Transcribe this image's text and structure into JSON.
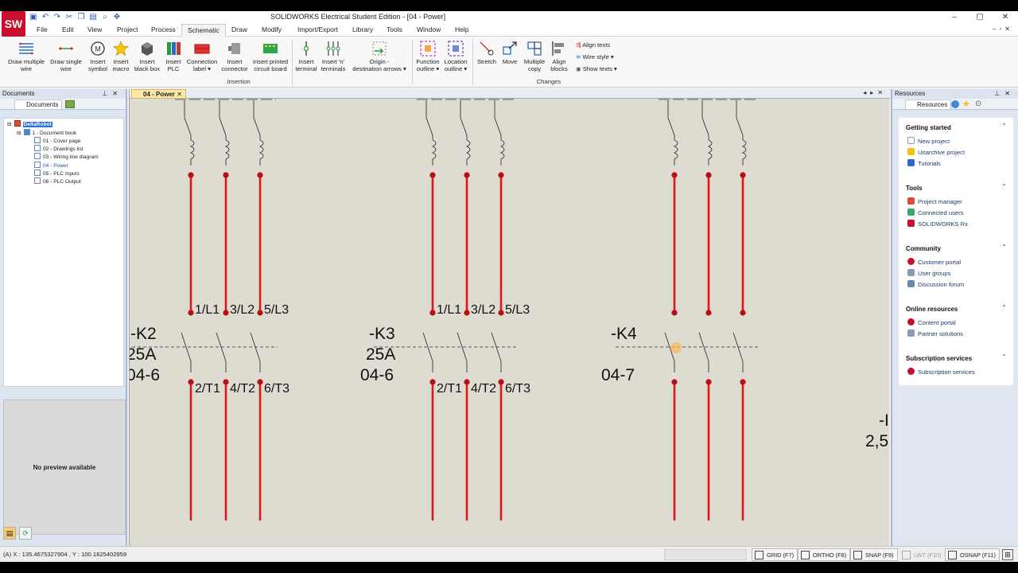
{
  "window": {
    "title": "SOLIDWORKS Electrical Student Edition - [04 - Power]",
    "logo": "SW",
    "controls": [
      "–",
      "▢",
      "✕"
    ]
  },
  "quick_access": [
    "save-icon",
    "undo-icon",
    "redo-icon",
    "cut-icon",
    "copy-icon",
    "paste-icon",
    "zoom-icon",
    "pan-icon"
  ],
  "menu": {
    "tabs": [
      "File",
      "Edit",
      "View",
      "Project",
      "Process",
      "Schematic",
      "Draw",
      "Modify",
      "Import/Export",
      "Library",
      "Tools",
      "Window",
      "Help"
    ],
    "active": "Schematic"
  },
  "ribbon": {
    "buttons": [
      {
        "label": "Draw multiple\nwire",
        "icon": "multiple-wire-icon"
      },
      {
        "label": "Draw single\nwire",
        "icon": "single-wire-icon"
      },
      {
        "label": "Insert\nsymbol",
        "icon": "symbol-icon"
      },
      {
        "label": "Insert\nmacro",
        "icon": "macro-star-icon"
      },
      {
        "label": "Insert\nblack box",
        "icon": "black-box-icon"
      },
      {
        "label": "Insert\nPLC",
        "icon": "plc-icon"
      },
      {
        "label": "Connection\nlabel ▾",
        "icon": "connection-label-icon"
      },
      {
        "label": "Insert\nconnector",
        "icon": "connector-icon"
      },
      {
        "label": "Insert printed\ncircuit board",
        "icon": "pcb-icon"
      },
      {
        "label": "Insert\nterminal",
        "icon": "terminal-icon"
      },
      {
        "label": "Insert 'n'\nterminals",
        "icon": "n-terminals-icon"
      },
      {
        "label": "Origin -\ndestination arrows ▾",
        "icon": "origin-arrows-icon"
      },
      {
        "label": "Function\noutline ▾",
        "icon": "function-outline-icon"
      },
      {
        "label": "Location\noutline ▾",
        "icon": "location-outline-icon"
      },
      {
        "label": "Stretch",
        "icon": "stretch-icon"
      },
      {
        "label": "Move",
        "icon": "move-icon"
      },
      {
        "label": "Multiple\ncopy",
        "icon": "multiple-copy-icon"
      },
      {
        "label": "Align\nblocks",
        "icon": "align-blocks-icon"
      }
    ],
    "small_buttons": [
      "Align texts",
      "Wire style ▾",
      "Show texts ▾"
    ],
    "groups": [
      "Insertion",
      "Changes"
    ]
  },
  "left_panel": {
    "title": "Documents",
    "tab": "Documents",
    "tree": [
      {
        "label": "DeltaRobot",
        "level": 0,
        "selected": true
      },
      {
        "label": "1 - Document book",
        "level": 1
      },
      {
        "label": "01 - Cover page",
        "level": 2
      },
      {
        "label": "02 - Drawings list",
        "level": 2
      },
      {
        "label": "03 - Wiring line diagram",
        "level": 2
      },
      {
        "label": "04 - Power",
        "level": 2,
        "active": true
      },
      {
        "label": "05 - PLC Inputs",
        "level": 2
      },
      {
        "label": "06 - PLC Output",
        "level": 2
      }
    ],
    "preview_text": "No preview available"
  },
  "canvas": {
    "tab": "04 - Power",
    "labels": {
      "k2": "-K2",
      "k2_rating": "25A",
      "k2_ref": "04-6",
      "k3": "-K3",
      "k3_rating": "25A",
      "k3_ref": "04-6",
      "k4": "-K4",
      "k4_ref": "04-7",
      "partial_tag": "-I",
      "partial_rating": "2,5",
      "top_pins_1": "1/L1",
      "top_pins_2": "3/L2",
      "top_pins_3": "5/L3",
      "bottom_pins_1": "2/T1",
      "bottom_pins_2": "4/T2",
      "bottom_pins_3": "6/T3"
    },
    "colors": {
      "wire": "#e0181b",
      "node": "#b80f12",
      "background": "#dedbd1"
    }
  },
  "right_panel": {
    "title": "Resources",
    "tab": "Resources",
    "sections": [
      {
        "title": "Getting started",
        "items": [
          "New project",
          "Unarchive project",
          "Tutorials"
        ]
      },
      {
        "title": "Tools",
        "items": [
          "Project manager",
          "Connected users",
          "SOLIDWORKS Rx"
        ]
      },
      {
        "title": "Community",
        "items": [
          "Customer portal",
          "User groups",
          "Discussion forum"
        ]
      },
      {
        "title": "Online resources",
        "items": [
          "Content portal",
          "Partner solutions"
        ]
      },
      {
        "title": "Subscription services",
        "items": [
          "Subscription services"
        ]
      }
    ]
  },
  "status": {
    "coords": "(A) X : 135.4675327904 , Y : 100.1825402959",
    "toggles": [
      {
        "label": "GRID (F7)",
        "on": true
      },
      {
        "label": "ORTHO (F8)",
        "on": true
      },
      {
        "label": "SNAP (F9)",
        "on": true
      },
      {
        "label": "LWT (F10)",
        "on": false
      },
      {
        "label": "OSNAP (F11)",
        "on": true
      }
    ]
  }
}
